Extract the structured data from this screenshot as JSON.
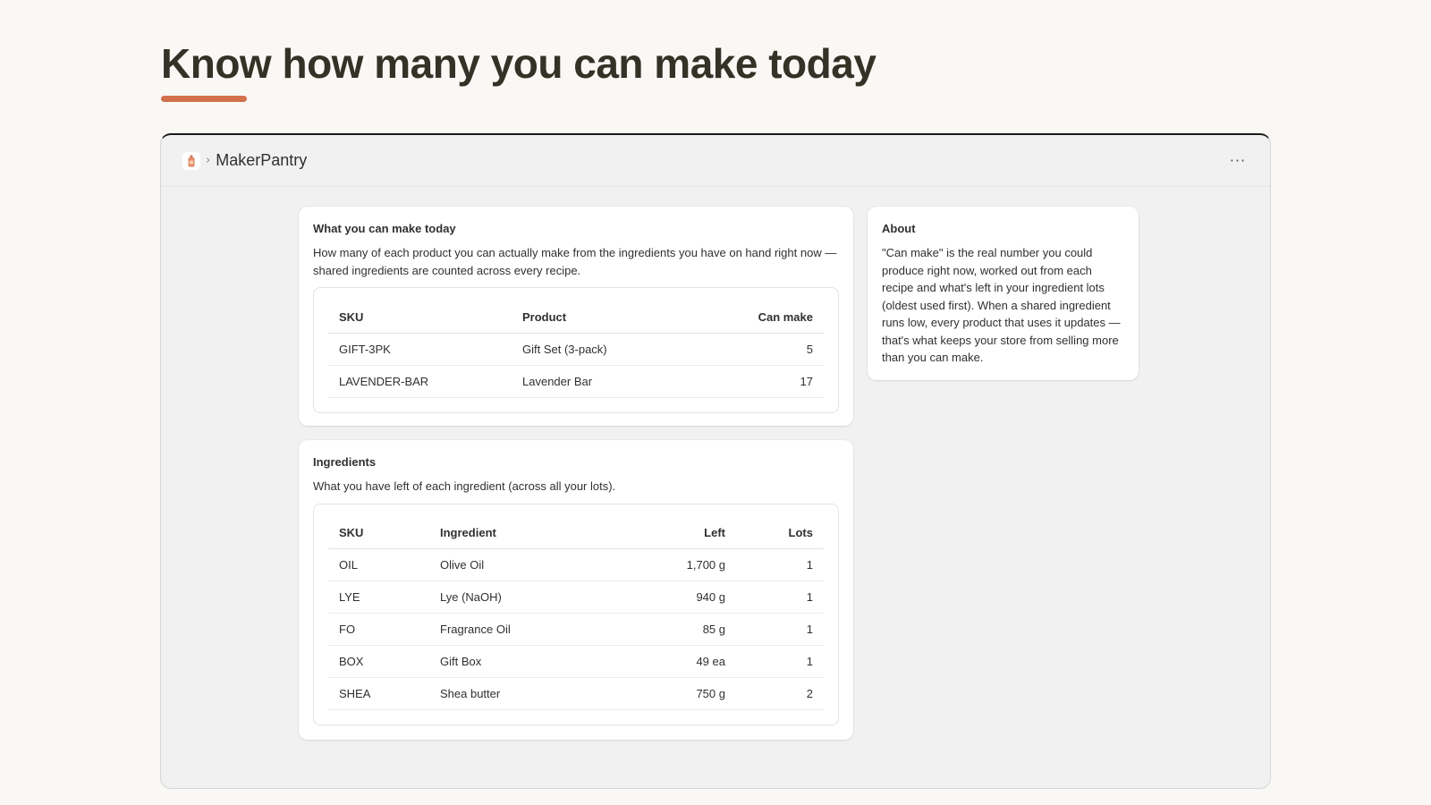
{
  "hero": {
    "title": "Know how many you can make today"
  },
  "window": {
    "app_name": "MakerPantry",
    "breadcrumb_separator": "›",
    "app_icon": "soap-bottle-icon",
    "more_icon": "more-horizontal-icon",
    "more_label": "···"
  },
  "can_make": {
    "title": "What you can make today",
    "description": "How many of each product you can actually make from the ingredients you have on hand right now — shared ingredients are counted across every recipe.",
    "columns": [
      "SKU",
      "Product",
      "Can make"
    ],
    "rows": [
      [
        "GIFT-3PK",
        "Gift Set (3-pack)",
        "5"
      ],
      [
        "LAVENDER-BAR",
        "Lavender Bar",
        "17"
      ]
    ]
  },
  "ingredients": {
    "title": "Ingredients",
    "description": "What you have left of each ingredient (across all your lots).",
    "columns": [
      "SKU",
      "Ingredient",
      "Left",
      "Lots"
    ],
    "rows": [
      [
        "OIL",
        "Olive Oil",
        "1,700 g",
        "1"
      ],
      [
        "LYE",
        "Lye (NaOH)",
        "940 g",
        "1"
      ],
      [
        "FO",
        "Fragrance Oil",
        "85 g",
        "1"
      ],
      [
        "BOX",
        "Gift Box",
        "49 ea",
        "1"
      ],
      [
        "SHEA",
        "Shea butter",
        "750 g",
        "2"
      ]
    ]
  },
  "about": {
    "title": "About",
    "text": "\"Can make\" is the real number you could produce right now, worked out from each recipe and what's left in your ingredient lots (oldest used first). When a shared ingredient runs low, every product that uses it updates — that's what keeps your store from selling more than you can make."
  },
  "colors": {
    "accent": "#d4714d",
    "heading": "#343226",
    "page_bg": "#f9f8f5",
    "window_bg": "#f1f1f1"
  }
}
